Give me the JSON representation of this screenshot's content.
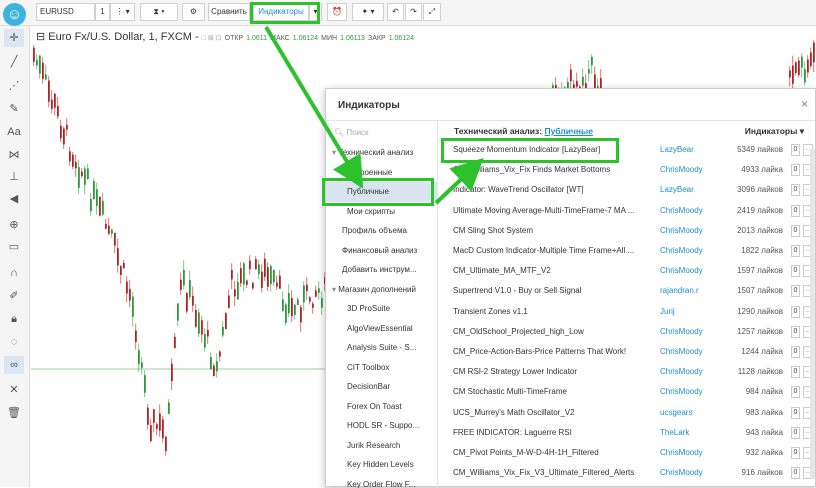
{
  "toolbar": {
    "symbol": "EURUSD",
    "interval": "1",
    "compare": "Сравнить",
    "indicators": "Индикаторы",
    "logo_icon": "smiley-logo-icon"
  },
  "legend": {
    "title": "Euro Fx/U.S. Dollar, 1, FXCM -",
    "open_label": "ОТКР",
    "open": "1.0611",
    "high_label": "МАКС",
    "high": "1.06124",
    "low_label": "МИН",
    "low": "1.06113",
    "close_label": "ЗАКР",
    "close": "1.06124"
  },
  "modal": {
    "title": "Индикаторы",
    "close": "×",
    "search_placeholder": "Поиск",
    "nav": [
      {
        "label": "Технический анализ",
        "indent": 1,
        "arrow": true
      },
      {
        "label": "Встроенные",
        "indent": 2
      },
      {
        "label": "Публичные",
        "indent": 2,
        "selected": true
      },
      {
        "label": "Мои скрипты",
        "indent": 2
      },
      {
        "label": "Профиль объема",
        "indent": 0
      },
      {
        "label": "Финансовый анализ",
        "indent": 0
      },
      {
        "label": "Добавить инструм...",
        "indent": 0
      },
      {
        "label": "Магазин дополнений",
        "indent": 1,
        "arrow": true
      },
      {
        "label": "3D ProSuite",
        "indent": 2
      },
      {
        "label": "AlgoViewEssential",
        "indent": 2
      },
      {
        "label": "Analysis Suite - S...",
        "indent": 2
      },
      {
        "label": "CIT Toolbox",
        "indent": 2
      },
      {
        "label": "DecisionBar",
        "indent": 2
      },
      {
        "label": "Forex On Toast",
        "indent": 2
      },
      {
        "label": "HODL SR - Suppo...",
        "indent": 2
      },
      {
        "label": "Jurik Research",
        "indent": 2
      },
      {
        "label": "Key Hidden Levels",
        "indent": 2
      },
      {
        "label": "Key Order Flow F...",
        "indent": 2
      }
    ],
    "section_prefix": "Технический анализ:",
    "section_link": "Публичные",
    "sort_label": "Индикаторы",
    "sort_arrow": "▾",
    "count_zero": "0",
    "more": "...",
    "rows": [
      {
        "name": "Squeeze Momentum Indicator [LazyBear]",
        "author": "LazyBear",
        "likes": "5349 лайков"
      },
      {
        "name": "CM_Williams_Vix_Fix Finds Market Bottoms",
        "author": "ChrisMoody",
        "likes": "4933 лайка"
      },
      {
        "name": "Indicator: WaveTrend Oscillator [WT]",
        "author": "LazyBear",
        "likes": "3096 лайков"
      },
      {
        "name": "Ultimate Moving Average-Multi-TimeFrame-7 MA ...",
        "author": "ChrisMoody",
        "likes": "2419 лайков"
      },
      {
        "name": "CM Sling Shot System",
        "author": "ChrisMoody",
        "likes": "2013 лайков"
      },
      {
        "name": "MacD Custom Indicator-Multiple Time Frame+All ...",
        "author": "ChrisMoody",
        "likes": "1822 лайка"
      },
      {
        "name": "CM_Ultimate_MA_MTF_V2",
        "author": "ChrisMoody",
        "likes": "1597 лайков"
      },
      {
        "name": "Supertrend V1.0 - Buy or Sell Signal",
        "author": "rajandran.r",
        "likes": "1507 лайков"
      },
      {
        "name": "Transient Zones v1.1",
        "author": "Jurij",
        "likes": "1290 лайков"
      },
      {
        "name": "CM_OldSchool_Projected_high_Low",
        "author": "ChrisMoody",
        "likes": "1257 лайков"
      },
      {
        "name": "CM_Price-Action-Bars-Price Patterns That Work!",
        "author": "ChrisMoody",
        "likes": "1244 лайка"
      },
      {
        "name": "CM RSI-2 Strategy Lower Indicator",
        "author": "ChrisMoody",
        "likes": "1128 лайков"
      },
      {
        "name": "CM Stochastic Multi-TimeFrame",
        "author": "ChrisMoody",
        "likes": "984 лайка"
      },
      {
        "name": "UCS_Murrey's Math Oscillator_V2",
        "author": "ucsgears",
        "likes": "983 лайка"
      },
      {
        "name": "FREE INDICATOR: Laguerre RSI",
        "author": "TheLark",
        "likes": "943 лайка"
      },
      {
        "name": "CM_Pivot Points_M-W-D-4H-1H_Filtered",
        "author": "ChrisMoody",
        "likes": "932 лайка"
      },
      {
        "name": "CM_Williams_Vix_Fix_V3_Ultimate_Filtered_Alerts",
        "author": "ChrisMoody",
        "likes": "916 лайков"
      }
    ]
  },
  "colors": {
    "highlight": "#2ec12e",
    "link": "#1a8fcf",
    "up_candle": "#2a9a3a",
    "down_candle": "#b22222"
  }
}
